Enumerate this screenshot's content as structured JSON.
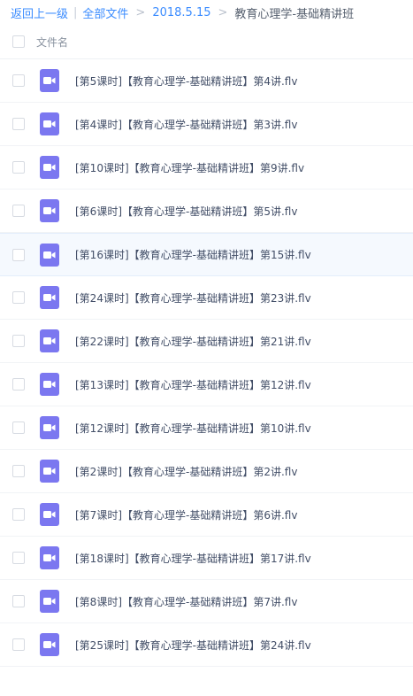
{
  "breadcrumb": {
    "back": "返回上一级",
    "separator_bar": "|",
    "all_files": "全部文件",
    "sep_arrow": ">",
    "folder_1": "2018.5.15",
    "current": "教育心理学-基础精讲班"
  },
  "header": {
    "column_label": "文件名"
  },
  "files": [
    {
      "name": "[第5课时]【教育心理学-基础精讲班】第4讲.flv"
    },
    {
      "name": "[第4课时]【教育心理学-基础精讲班】第3讲.flv"
    },
    {
      "name": "[第10课时]【教育心理学-基础精讲班】第9讲.flv"
    },
    {
      "name": "[第6课时]【教育心理学-基础精讲班】第5讲.flv"
    },
    {
      "name": "[第16课时]【教育心理学-基础精讲班】第15讲.flv"
    },
    {
      "name": "[第24课时]【教育心理学-基础精讲班】第23讲.flv"
    },
    {
      "name": "[第22课时]【教育心理学-基础精讲班】第21讲.flv"
    },
    {
      "name": "[第13课时]【教育心理学-基础精讲班】第12讲.flv"
    },
    {
      "name": "[第12课时]【教育心理学-基础精讲班】第10讲.flv"
    },
    {
      "name": "[第2课时]【教育心理学-基础精讲班】第2讲.flv"
    },
    {
      "name": "[第7课时]【教育心理学-基础精讲班】第6讲.flv"
    },
    {
      "name": "[第18课时]【教育心理学-基础精讲班】第17讲.flv"
    },
    {
      "name": "[第8课时]【教育心理学-基础精讲班】第7讲.flv"
    },
    {
      "name": "[第25课时]【教育心理学-基础精讲班】第24讲.flv"
    }
  ],
  "icon": "video-file-icon",
  "colors": {
    "link": "#3b8cff",
    "icon": "#7b77f0",
    "hover_row": "#f5f9fe"
  }
}
